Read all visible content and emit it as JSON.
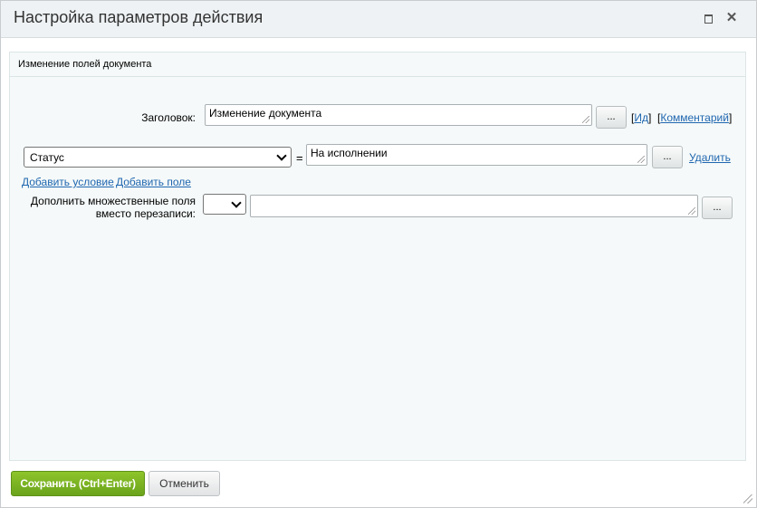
{
  "dialog": {
    "title": "Настройка параметров действия",
    "maximize_icon": "maximize-icon",
    "close_icon": "close-icon",
    "close_glyph": "✕"
  },
  "panel": {
    "title": "Изменение полей документа"
  },
  "title_row": {
    "label": "Заголовок:",
    "value": "Изменение документа",
    "dots": "...",
    "id_link": "Ид",
    "comment_link": "Комментарий"
  },
  "field_row": {
    "field_select": "Статус",
    "equals": "=",
    "value": "На исполнении",
    "dots": "...",
    "delete_link": "Удалить"
  },
  "links": {
    "add_condition": "Добавить условие",
    "add_field": "Добавить поле"
  },
  "multi_row": {
    "label_line1": "Дополнить множественные поля",
    "label_line2": "вместо перезаписи:",
    "select_value": "",
    "value": "",
    "dots": "..."
  },
  "footer": {
    "save": "Сохранить (Ctrl+Enter)",
    "cancel": "Отменить"
  },
  "colors": {
    "save_green": "#7ab723",
    "link_blue": "#2067b0",
    "panel_bg": "#f5f9f9",
    "titlebar_bg": "#eef2f4"
  }
}
